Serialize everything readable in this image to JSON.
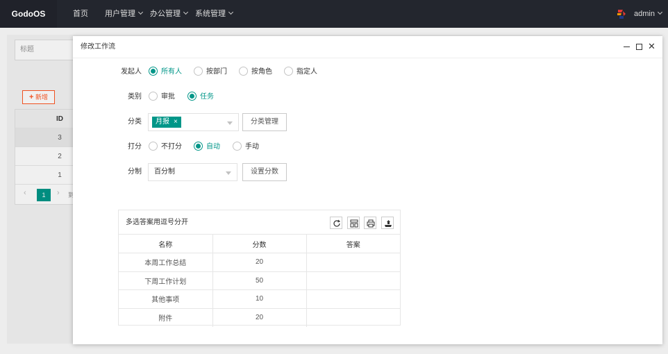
{
  "topbar": {
    "brand": "GodoOS",
    "nav": [
      "首页",
      "用户管理",
      "办公管理",
      "系统管理"
    ],
    "user": "admin"
  },
  "background": {
    "search_placeholder": "标题",
    "add_label": "新增",
    "table_header": "ID",
    "rows": [
      "3",
      "2",
      "1"
    ],
    "page": "1",
    "jump": "到"
  },
  "modal": {
    "title": "修改工作流",
    "fields": {
      "initiator": {
        "label": "发起人",
        "options": [
          "所有人",
          "按部门",
          "按角色",
          "指定人"
        ],
        "selected": "所有人"
      },
      "category": {
        "label": "类别",
        "options": [
          "审批",
          "任务"
        ],
        "selected": "任务"
      },
      "classify": {
        "label": "分类",
        "tag": "月报",
        "tag_close": "×",
        "manage_button": "分类管理"
      },
      "scoring": {
        "label": "打分",
        "options": [
          "不打分",
          "自动",
          "手动"
        ],
        "selected": "自动"
      },
      "scale": {
        "label": "分制",
        "value": "百分制",
        "set_button": "设置分数"
      }
    },
    "grid": {
      "title": "多选答案用逗号分开",
      "columns": [
        "名称",
        "分数",
        "答案"
      ],
      "rows": [
        {
          "name": "本周工作总结",
          "score": "20",
          "answer": ""
        },
        {
          "name": "下周工作计划",
          "score": "50",
          "answer": ""
        },
        {
          "name": "其他事项",
          "score": "10",
          "answer": ""
        },
        {
          "name": "附件",
          "score": "20",
          "answer": ""
        }
      ]
    }
  },
  "colors": {
    "accent": "#009688",
    "topbar": "#23262e",
    "danger": "#ff5722"
  }
}
